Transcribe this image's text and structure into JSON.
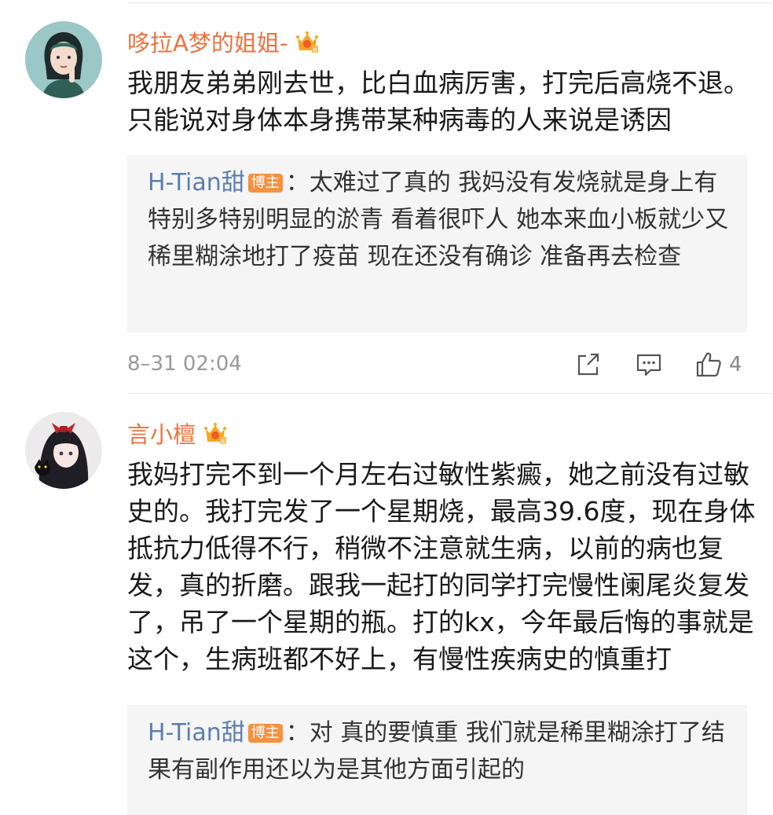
{
  "comments": [
    {
      "username": "哆拉A梦的姐姐-",
      "body": "我朋友弟弟刚去世，比白血病厉害，打完后高烧不退。\n只能说对身体本身携带某种病毒的人来说是诱因",
      "reply": {
        "user": "H-Tian甜",
        "badge": "博主",
        "text": "：太难过了真的 我妈没有发烧就是身上有特别多特别明显的淤青 看着很吓人 她本来血小板就少又稀里糊涂地打了疫苗  现在还没有确诊  准备再去检查"
      },
      "timestamp": "8–31 02:04",
      "likes": "4"
    },
    {
      "username": "言小檀",
      "body": "我妈打完不到一个月左右过敏性紫癜，她之前没有过敏\n史的。我打完发了一个星期烧，最高39.6度，现在身体\n抵抗力低得不行，稍微不注意就生病，以前的病也复\n发，真的折磨。跟我一起打的同学打完慢性阑尾炎复发\n了，吊了一个星期的瓶。打的kx，今年最后悔的事就是\n这个，生病班都不好上，有慢性疾病史的慎重打",
      "reply": {
        "user": "H-Tian甜",
        "badge": "博主",
        "text": "：对 真的要慎重 我们就是稀里糊涂打了结果有副作用还以为是其他方面引起的"
      }
    }
  ],
  "icons": {
    "crown": "vip-crown-icon",
    "share": "share-icon",
    "comment": "comment-icon",
    "like": "thumbs-up-icon"
  },
  "colors": {
    "username": "#eb7340",
    "reply_user": "#5b7fae",
    "badge": "#f6913e",
    "reply_bg": "#f5f5f5"
  }
}
